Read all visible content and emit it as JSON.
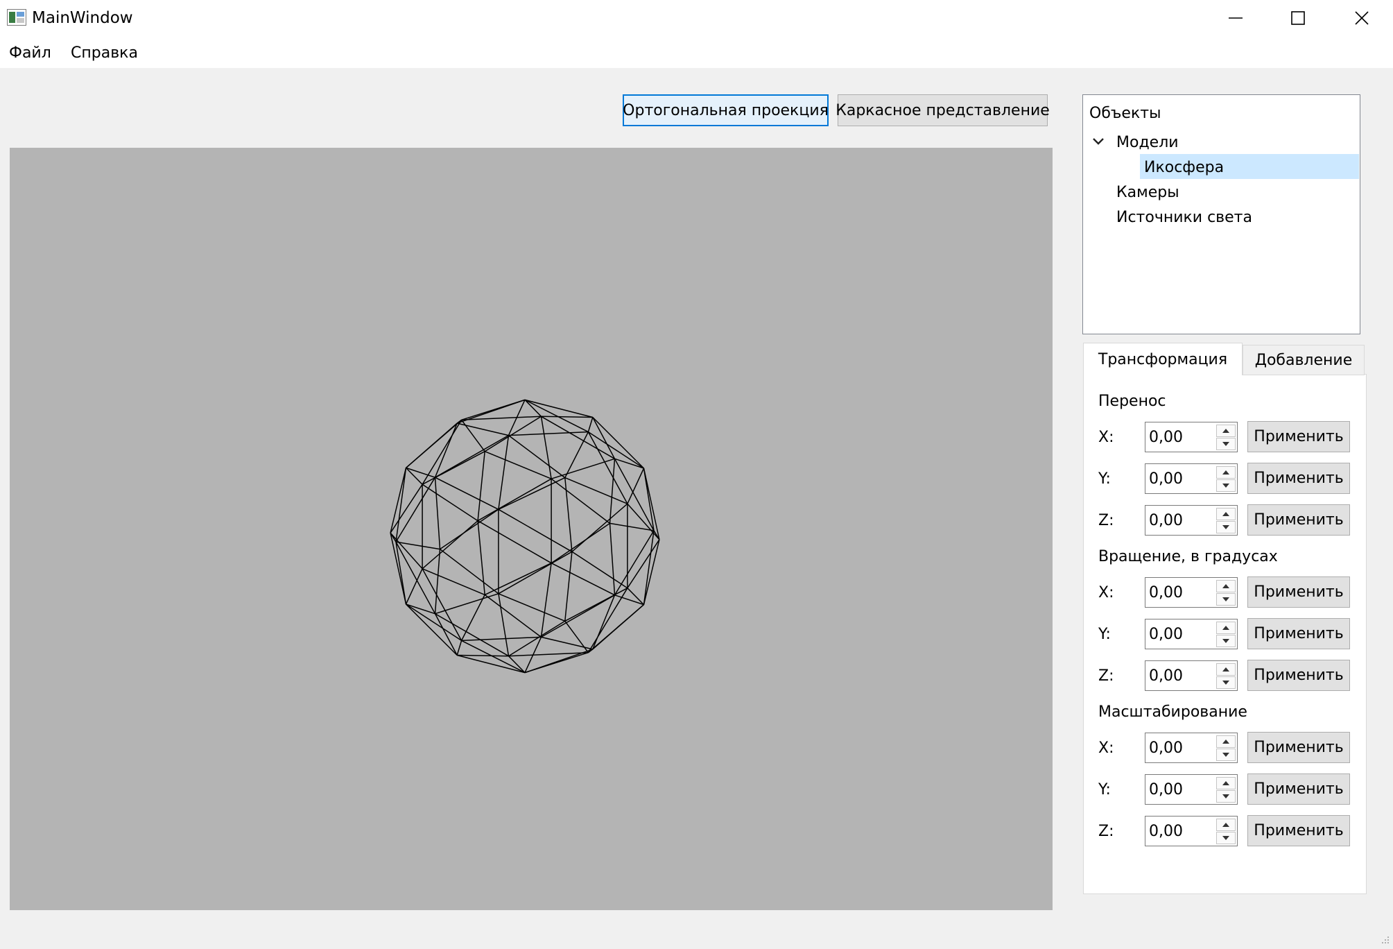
{
  "window": {
    "title": "MainWindow"
  },
  "menu": {
    "items": [
      "Файл",
      "Справка"
    ]
  },
  "toolbar": {
    "ortho_label": "Ортогональная проекция",
    "wire_label": "Каркасное представление"
  },
  "tree": {
    "root": "Объекты",
    "models": "Модели",
    "selected_model": "Икосфера",
    "cameras": "Камеры",
    "lights": "Источники света"
  },
  "tabs": [
    "Трансформация",
    "Добавление"
  ],
  "groups": [
    {
      "title": "Перенос",
      "rows": [
        {
          "axis": "X:",
          "value": "0,00"
        },
        {
          "axis": "Y:",
          "value": "0,00"
        },
        {
          "axis": "Z:",
          "value": "0,00"
        }
      ]
    },
    {
      "title": "Вращение, в градусах",
      "rows": [
        {
          "axis": "X:",
          "value": "0,00"
        },
        {
          "axis": "Y:",
          "value": "0,00"
        },
        {
          "axis": "Z:",
          "value": "0,00"
        }
      ]
    },
    {
      "title": "Масштабирование",
      "rows": [
        {
          "axis": "X:",
          "value": "0,00"
        },
        {
          "axis": "Y:",
          "value": "0,00"
        },
        {
          "axis": "Z:",
          "value": "0,00"
        }
      ]
    }
  ],
  "apply_label": "Применить",
  "icons": {
    "app": "app-icon",
    "minimize": "minimize-icon",
    "maximize": "maximize-icon",
    "close": "close-icon",
    "expand": "chevron-down-icon",
    "spin_up": "spin-up-arrow-icon",
    "spin_down": "spin-down-arrow-icon",
    "resize": "size-grip-icon"
  },
  "colors": {
    "viewport_bg": "#b4b4b4",
    "wireframe": "#000000",
    "selection": "#cce8ff",
    "focus_border": "#0078d7",
    "window_bg": "#f0f0f0"
  }
}
